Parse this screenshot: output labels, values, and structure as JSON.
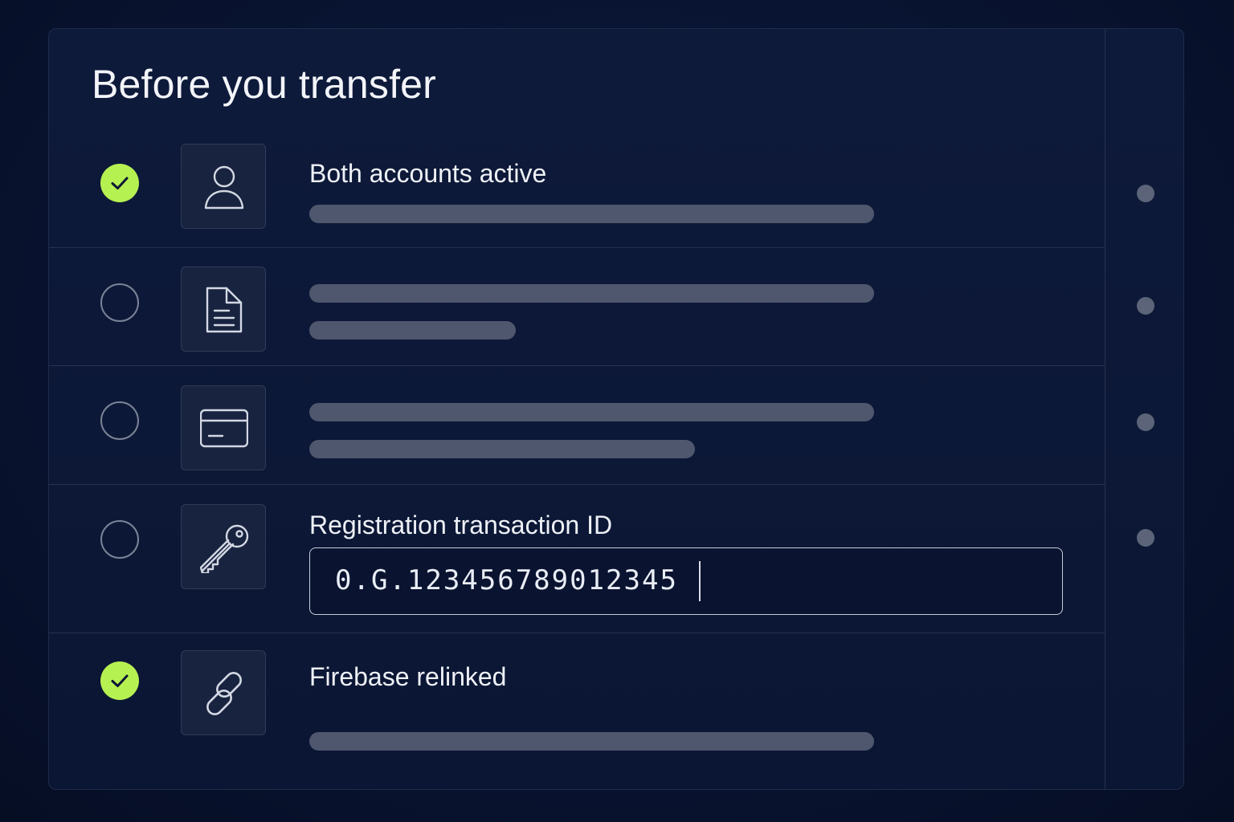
{
  "title": "Before you transfer",
  "colors": {
    "background": "#07112a",
    "panel": "#0e1a3a",
    "success": "#b6f152",
    "placeholder_bar": "#4e576d",
    "divider": "#26324f"
  },
  "checklist": [
    {
      "status": "complete",
      "icon": "user-icon",
      "label": "Both accounts active"
    },
    {
      "status": "pending",
      "icon": "document-icon",
      "label": ""
    },
    {
      "status": "pending",
      "icon": "credit-card-icon",
      "label": ""
    },
    {
      "status": "pending",
      "icon": "key-icon",
      "label": "Registration transaction ID",
      "input": {
        "value": "0.G.123456789012345"
      }
    },
    {
      "status": "complete",
      "icon": "link-icon",
      "label": "Firebase relinked"
    }
  ]
}
